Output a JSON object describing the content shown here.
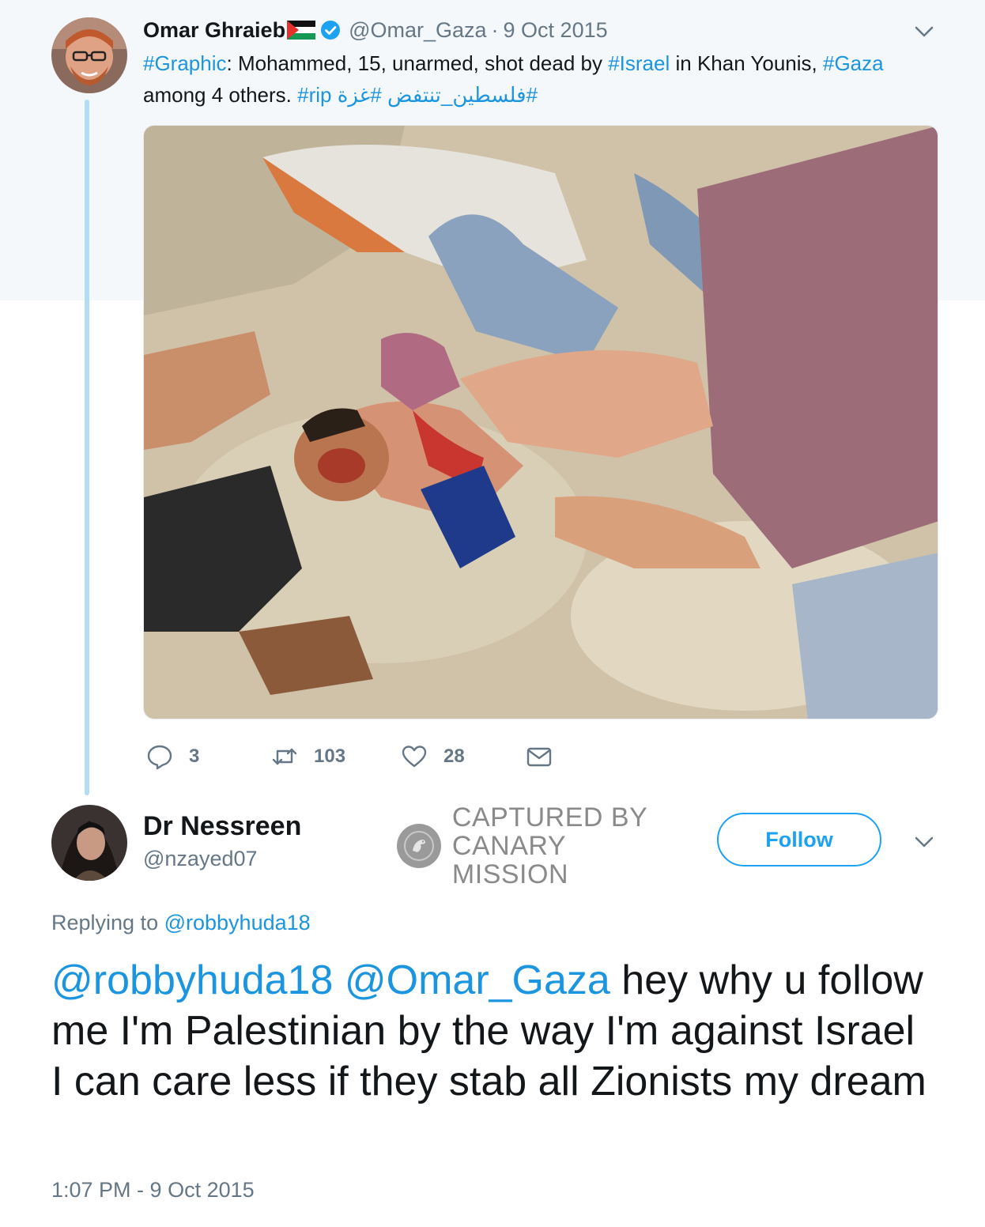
{
  "tweet1": {
    "author_name": "Omar Ghraieb",
    "handle": "@Omar_Gaza",
    "separator": "·",
    "date": "9 Oct 2015",
    "text": {
      "hashtag_graphic": "#Graphic",
      "part1": ": Mohammed, 15, unarmed, shot dead by ",
      "hashtag_israel": "#Israel",
      "part2": " in Khan Younis, ",
      "hashtag_gaza": "#Gaza",
      "part3": " among 4 others. ",
      "hashtag_rip": "#rip",
      "hashtag_arabic1": "#غزة",
      "hashtag_arabic2": "#فلسطين_تنتفض"
    },
    "stats": {
      "replies": "3",
      "retweets": "103",
      "likes": "28"
    },
    "icons": [
      "chevron-down-icon",
      "verified-badge-icon",
      "palestine-flag-icon",
      "reply-icon",
      "retweet-icon",
      "like-icon",
      "direct-message-icon"
    ]
  },
  "tweet2": {
    "author_name": "Dr Nessreen",
    "handle": "@nzayed07",
    "follow_label": "Follow",
    "replying_prefix": "Replying to",
    "replying_to": "@robbyhuda18",
    "mention1": "@robbyhuda18",
    "mention2": "@Omar_Gaza",
    "body": " hey why u follow me I'm Palestinian by the way I'm against Israel I can care less if they stab all Zionists my dream",
    "timestamp": "1:07 PM - 9 Oct 2015"
  },
  "watermark": {
    "line1": "CAPTURED BY",
    "line2": "CANARY MISSION"
  },
  "colors": {
    "link": "#1b95e0",
    "follow": "#1da1f2",
    "muted": "#657786",
    "thread_line": "#b3dcf6",
    "top_background": "#f5f8fa"
  }
}
